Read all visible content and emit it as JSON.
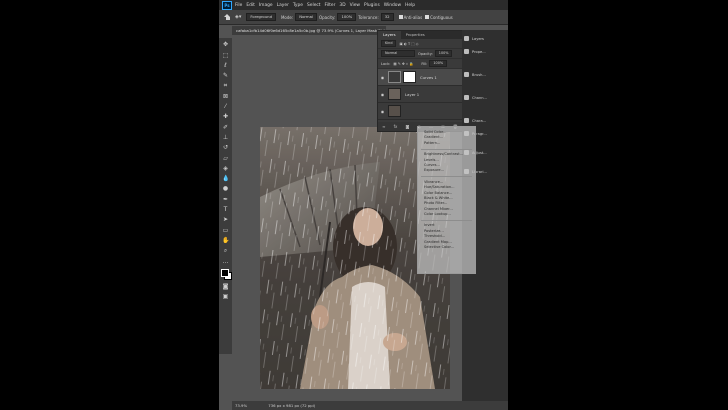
{
  "menubar": {
    "items": [
      "File",
      "Edit",
      "Image",
      "Layer",
      "Type",
      "Select",
      "Filter",
      "3D",
      "View",
      "Plugins",
      "Window",
      "Help"
    ]
  },
  "options": {
    "preset": "Foreground",
    "mode_label": "Mode:",
    "mode_value": "Normal",
    "opacity_label": "Opacity:",
    "opacity_value": "100%",
    "tolerance_label": "Tolerance:",
    "tolerance_value": "32",
    "antialias_label": "Anti-alias",
    "contiguous_label": "Contiguous"
  },
  "document": {
    "tab_title": "cafaba1cfb14d06f0e6d165c8e1a5c0b.jpg @ 73.9% (Curves 1, Layer Mask/8) *",
    "zoom": "73.9%",
    "doc_info": "736 px x 981 px (72 ppi)"
  },
  "layers": {
    "tabs": [
      "Layers",
      "Properties"
    ],
    "kind_label": "Kind",
    "blend_mode": "Normal",
    "opacity_label": "Opacity:",
    "opacity_value": "100%",
    "lock_label": "Lock:",
    "fill_label": "Fill:",
    "fill_value": "100%",
    "items": [
      {
        "name": "Curves 1"
      },
      {
        "name": "Layer 1"
      },
      {
        "name": ""
      }
    ]
  },
  "right_panel": {
    "items": [
      "Layers",
      "Prope...",
      "Brush...",
      "Chann...",
      "Chara...",
      "Paragr...",
      "Adjust...",
      "Librari..."
    ]
  },
  "adjustment_menu": {
    "groups": [
      [
        "Solid Color...",
        "Gradient...",
        "Pattern..."
      ],
      [
        "Brightness/Contrast...",
        "Levels...",
        "Curves...",
        "Exposure..."
      ],
      [
        "Vibrance...",
        "Hue/Saturation...",
        "Color Balance...",
        "Black & White...",
        "Photo Filter...",
        "Channel Mixer...",
        "Color Lookup..."
      ],
      [
        "Invert",
        "Posterize...",
        "Threshold...",
        "Gradient Map...",
        "Selective Color..."
      ]
    ]
  },
  "colors": {
    "accent": "#31a8ff",
    "panel_bg": "#535353",
    "menubar_bg": "#2b2b2b"
  }
}
